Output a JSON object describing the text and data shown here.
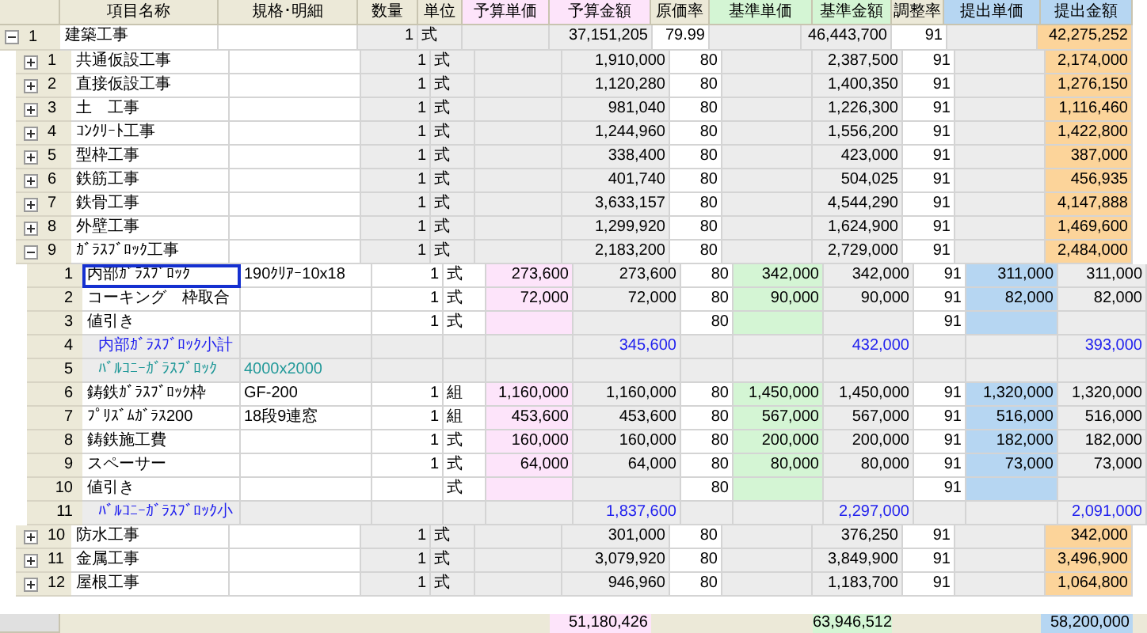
{
  "columns": [
    {
      "label": "項目名称",
      "color": "#ece9d8"
    },
    {
      "label": "規格･明細",
      "color": "#ece9d8"
    },
    {
      "label": "数量",
      "color": "#ece9d8"
    },
    {
      "label": "単位",
      "color": "#ece9d8"
    },
    {
      "label": "予算単価",
      "color": "#fde4fa"
    },
    {
      "label": "予算金額",
      "color": "#fde4fa"
    },
    {
      "label": "原価率",
      "color": "#ece9d8"
    },
    {
      "label": "基準単価",
      "color": "#d4f5d4"
    },
    {
      "label": "基準金額",
      "color": "#d4f5d4"
    },
    {
      "label": "調整率",
      "color": "#ece9d8"
    },
    {
      "label": "提出単価",
      "color": "#b6d6f2"
    },
    {
      "label": "提出金額",
      "color": "#b6d6f2"
    }
  ],
  "tree": [
    {
      "no": "1",
      "name": "建築工事",
      "qty": "1",
      "unit": "式",
      "budget_amount": "37,151,205",
      "cost_rate": "79.99",
      "std_amount": "46,443,700",
      "adj_rate": "91",
      "sub_amount": "42,275,252",
      "expanded": true,
      "children": [
        {
          "no": "1",
          "name": "共通仮設工事",
          "qty": "1",
          "unit": "式",
          "budget_amount": "1,910,000",
          "cost_rate": "80",
          "std_amount": "2,387,500",
          "adj_rate": "91",
          "sub_amount": "2,174,000",
          "expanded": false
        },
        {
          "no": "2",
          "name": "直接仮設工事",
          "qty": "1",
          "unit": "式",
          "budget_amount": "1,120,280",
          "cost_rate": "80",
          "std_amount": "1,400,350",
          "adj_rate": "91",
          "sub_amount": "1,276,150",
          "expanded": false
        },
        {
          "no": "3",
          "name": "土　工事",
          "qty": "1",
          "unit": "式",
          "budget_amount": "981,040",
          "cost_rate": "80",
          "std_amount": "1,226,300",
          "adj_rate": "91",
          "sub_amount": "1,116,460",
          "expanded": false
        },
        {
          "no": "4",
          "name": "ｺﾝｸﾘｰﾄ工事",
          "qty": "1",
          "unit": "式",
          "budget_amount": "1,244,960",
          "cost_rate": "80",
          "std_amount": "1,556,200",
          "adj_rate": "91",
          "sub_amount": "1,422,800",
          "expanded": false
        },
        {
          "no": "5",
          "name": "型枠工事",
          "qty": "1",
          "unit": "式",
          "budget_amount": "338,400",
          "cost_rate": "80",
          "std_amount": "423,000",
          "adj_rate": "91",
          "sub_amount": "387,000",
          "expanded": false
        },
        {
          "no": "6",
          "name": "鉄筋工事",
          "qty": "1",
          "unit": "式",
          "budget_amount": "401,740",
          "cost_rate": "80",
          "std_amount": "504,025",
          "adj_rate": "91",
          "sub_amount": "456,935",
          "expanded": false
        },
        {
          "no": "7",
          "name": "鉄骨工事",
          "qty": "1",
          "unit": "式",
          "budget_amount": "3,633,157",
          "cost_rate": "80",
          "std_amount": "4,544,290",
          "adj_rate": "91",
          "sub_amount": "4,147,888",
          "expanded": false
        },
        {
          "no": "8",
          "name": "外壁工事",
          "qty": "1",
          "unit": "式",
          "budget_amount": "1,299,920",
          "cost_rate": "80",
          "std_amount": "1,624,900",
          "adj_rate": "91",
          "sub_amount": "1,469,600",
          "expanded": false
        },
        {
          "no": "9",
          "name": "ｶﾞﾗｽﾌﾞﾛｯｸ工事",
          "qty": "1",
          "unit": "式",
          "budget_amount": "2,183,200",
          "cost_rate": "80",
          "std_amount": "2,729,000",
          "adj_rate": "91",
          "sub_amount": "2,484,000",
          "expanded": true,
          "children": [
            {
              "kind": "item",
              "selected": true,
              "no": "1",
              "name": "内部ｶﾞﾗｽﾌﾞﾛｯｸ",
              "spec": "190ｸﾘｱｰ10x18",
              "qty": "1",
              "unit": "式",
              "budget_unit": "273,600",
              "budget_amount": "273,600",
              "cost_rate": "80",
              "std_unit": "342,000",
              "std_amount": "342,000",
              "adj_rate": "91",
              "sub_unit": "311,000",
              "sub_amount": "311,000"
            },
            {
              "kind": "item",
              "selected": false,
              "no": "2",
              "name": "コーキング　枠取合",
              "qty": "1",
              "unit": "式",
              "budget_unit": "72,000",
              "budget_amount": "72,000",
              "cost_rate": "80",
              "std_unit": "90,000",
              "std_amount": "90,000",
              "adj_rate": "91",
              "sub_unit": "82,000",
              "sub_amount": "82,000"
            },
            {
              "kind": "item",
              "selected": false,
              "no": "3",
              "name": "値引き",
              "qty": "1",
              "unit": "式",
              "cost_rate": "80",
              "adj_rate": "91"
            },
            {
              "kind": "subtotal",
              "selected": false,
              "no": "4",
              "name": "内部ｶﾞﾗｽﾌﾞﾛｯｸ小計",
              "budget_amount": "345,600",
              "std_amount": "432,000",
              "sub_amount": "393,000"
            },
            {
              "kind": "heading",
              "selected": false,
              "no": "5",
              "name": "ﾊﾞﾙｺﾆｰｶﾞﾗｽﾌﾞﾛｯｸ",
              "spec": "4000x2000"
            },
            {
              "kind": "item",
              "selected": false,
              "no": "6",
              "name": "鋳鉄ｶﾞﾗｽﾌﾞﾛｯｸ枠",
              "spec": "GF-200",
              "qty": "1",
              "unit": "組",
              "budget_unit": "1,160,000",
              "budget_amount": "1,160,000",
              "cost_rate": "80",
              "std_unit": "1,450,000",
              "std_amount": "1,450,000",
              "adj_rate": "91",
              "sub_unit": "1,320,000",
              "sub_amount": "1,320,000"
            },
            {
              "kind": "item",
              "selected": false,
              "no": "7",
              "name": "ﾌﾟﾘｽﾞﾑｶﾞﾗｽ200",
              "spec": "18段9連窓",
              "qty": "1",
              "unit": "組",
              "budget_unit": "453,600",
              "budget_amount": "453,600",
              "cost_rate": "80",
              "std_unit": "567,000",
              "std_amount": "567,000",
              "adj_rate": "91",
              "sub_unit": "516,000",
              "sub_amount": "516,000"
            },
            {
              "kind": "item",
              "selected": false,
              "no": "8",
              "name": "鋳鉄施工費",
              "qty": "1",
              "unit": "式",
              "budget_unit": "160,000",
              "budget_amount": "160,000",
              "cost_rate": "80",
              "std_unit": "200,000",
              "std_amount": "200,000",
              "adj_rate": "91",
              "sub_unit": "182,000",
              "sub_amount": "182,000"
            },
            {
              "kind": "item",
              "selected": false,
              "no": "9",
              "name": "スペーサー",
              "qty": "1",
              "unit": "式",
              "budget_unit": "64,000",
              "budget_amount": "64,000",
              "cost_rate": "80",
              "std_unit": "80,000",
              "std_amount": "80,000",
              "adj_rate": "91",
              "sub_unit": "73,000",
              "sub_amount": "73,000"
            },
            {
              "kind": "item",
              "selected": false,
              "no": "10",
              "name": "値引き",
              "unit": "式",
              "cost_rate": "80",
              "adj_rate": "91"
            },
            {
              "kind": "subtotal",
              "selected": false,
              "no": "11",
              "name": "ﾊﾞﾙｺﾆｰｶﾞﾗｽﾌﾞﾛｯｸ小",
              "budget_amount": "1,837,600",
              "std_amount": "2,297,000",
              "sub_amount": "2,091,000"
            }
          ]
        },
        {
          "no": "10",
          "name": "防水工事",
          "qty": "1",
          "unit": "式",
          "budget_amount": "301,000",
          "cost_rate": "80",
          "std_amount": "376,250",
          "adj_rate": "91",
          "sub_amount": "342,000",
          "expanded": false
        },
        {
          "no": "11",
          "name": "金属工事",
          "qty": "1",
          "unit": "式",
          "budget_amount": "3,079,920",
          "cost_rate": "80",
          "std_amount": "3,849,900",
          "adj_rate": "91",
          "sub_amount": "3,496,900",
          "expanded": false
        },
        {
          "no": "12",
          "name": "屋根工事",
          "qty": "1",
          "unit": "式",
          "budget_amount": "946,960",
          "cost_rate": "80",
          "std_amount": "1,183,700",
          "adj_rate": "91",
          "sub_amount": "1,064,800",
          "expanded": false
        }
      ]
    }
  ],
  "totals": {
    "budget_amount": "51,180,426",
    "std_amount": "63,946,512",
    "sub_amount": "58,200,000"
  }
}
